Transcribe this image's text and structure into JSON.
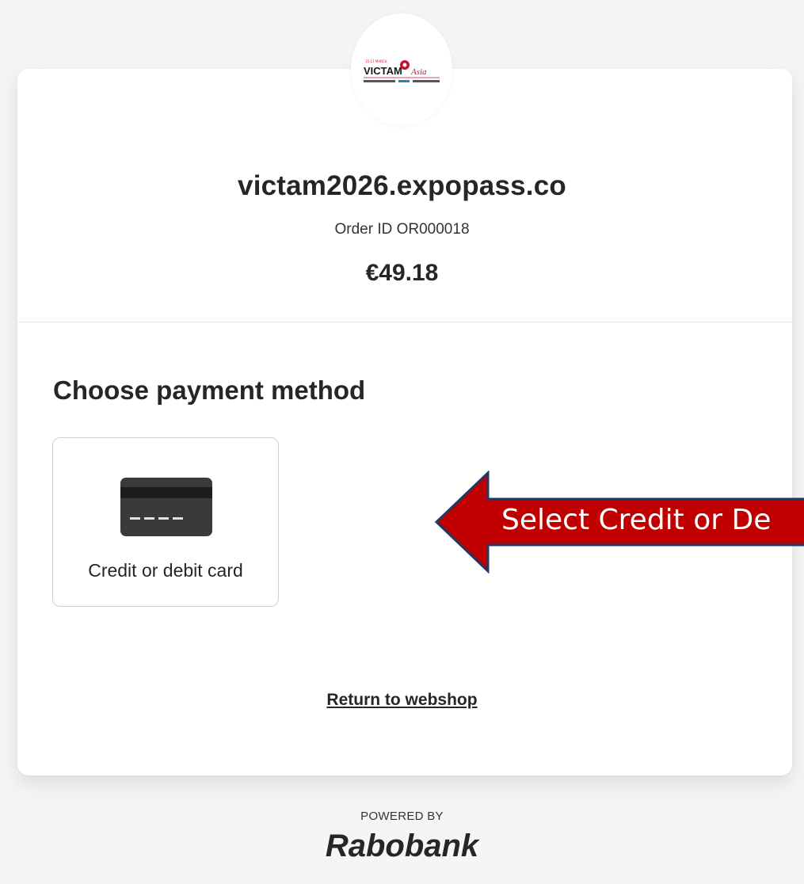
{
  "merchant": {
    "domain": "victam2026.expopass.co",
    "order_id": "Order ID OR000018",
    "amount": "€49.18"
  },
  "logo": {
    "brand_text": "VICTAM",
    "script_text": "Asia",
    "color": "#c8102e"
  },
  "payment": {
    "title": "Choose payment method",
    "methods": [
      {
        "label": "Credit or debit card",
        "icon": "credit-card-icon"
      }
    ]
  },
  "return_link": "Return to webshop",
  "footer": {
    "powered_by": "POWERED BY",
    "provider": "Rabobank"
  },
  "annotation": {
    "text": "Select Credit or De",
    "fill": "#c00000",
    "stroke": "#1f3864"
  }
}
